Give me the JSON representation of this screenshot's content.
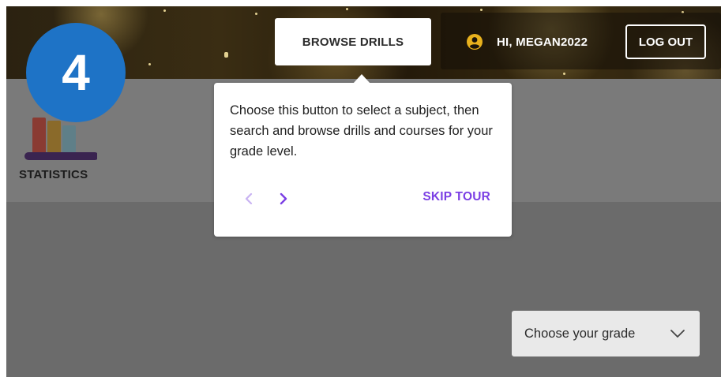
{
  "header": {
    "browse_label": "BROWSE DRILLS",
    "greeting": "HI, MEGAN2022",
    "logout_label": "LOG OUT",
    "user_icon": "user-circle-icon"
  },
  "tour": {
    "step_number": "4",
    "text": "Choose this button to select a subject, then search and browse drills and courses for your grade level.",
    "prev_icon": "chevron-left-icon",
    "next_icon": "chevron-right-icon",
    "skip_label": "SKIP TOUR"
  },
  "sidebar": {
    "statistics_label": "STATISTICS",
    "statistics_icon": "bar-chart-icon"
  },
  "filters": {
    "grade_placeholder": "Choose your grade",
    "grade_icon": "chevron-down-icon"
  },
  "colors": {
    "accent_purple": "#7b3fe4",
    "badge_blue": "#1e73c6",
    "user_icon_amber": "#e8b11d",
    "overlay_gray": "#757575"
  }
}
